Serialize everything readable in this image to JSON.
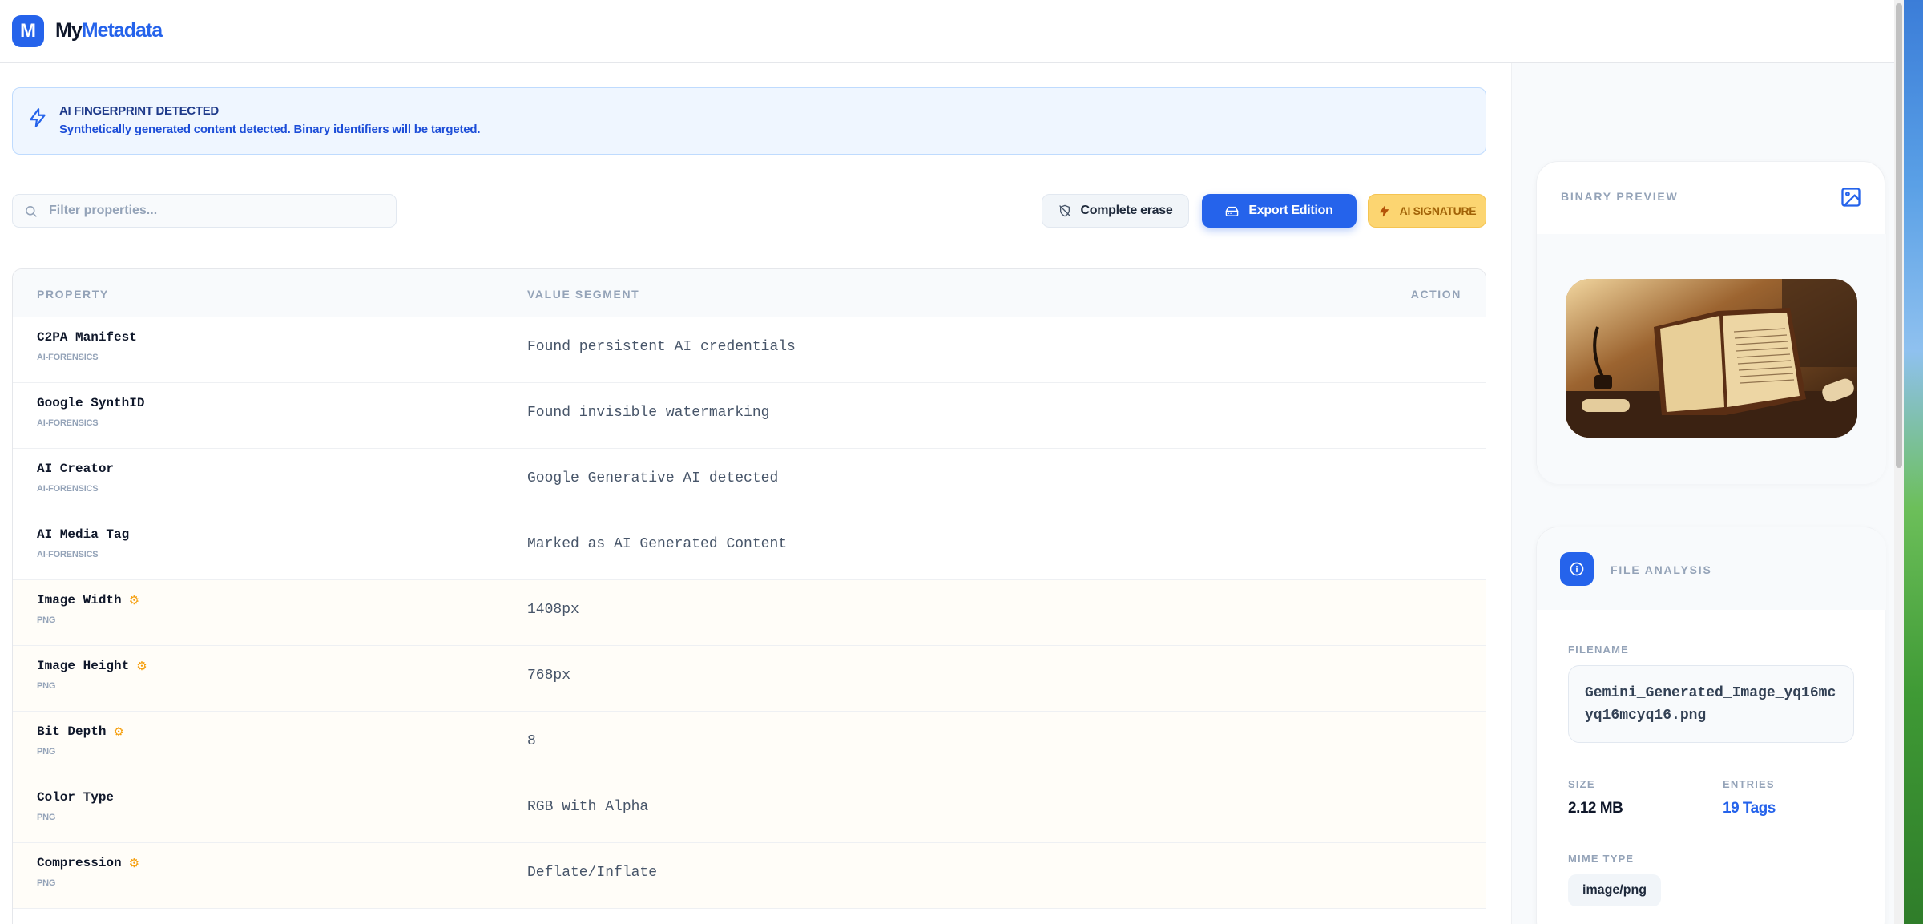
{
  "app": {
    "logo_letter": "M",
    "name_part1": "My",
    "name_part2": "Metadata"
  },
  "alert": {
    "title": "AI FINGERPRINT DETECTED",
    "message": "Synthetically generated content detected. Binary identifiers will be targeted."
  },
  "search": {
    "placeholder": "Filter properties...",
    "value": ""
  },
  "toolbar": {
    "erase_label": "Complete erase",
    "export_label": "Export Edition",
    "signature_label": "AI SIGNATURE"
  },
  "table": {
    "headers": {
      "property": "PROPERTY",
      "value": "VALUE SEGMENT",
      "action": "ACTION"
    },
    "rows": [
      {
        "property": "C2PA Manifest",
        "category": "AI-FORENSICS",
        "value": "Found persistent AI credentials",
        "editable_icon": false
      },
      {
        "property": "Google SynthID",
        "category": "AI-FORENSICS",
        "value": "Found invisible watermarking",
        "editable_icon": false
      },
      {
        "property": "AI Creator",
        "category": "AI-FORENSICS",
        "value": "Google Generative AI detected",
        "editable_icon": false
      },
      {
        "property": "AI Media Tag",
        "category": "AI-FORENSICS",
        "value": "Marked as AI Generated Content",
        "editable_icon": false
      },
      {
        "property": "Image Width",
        "category": "PNG",
        "value": "1408px",
        "editable_icon": true
      },
      {
        "property": "Image Height",
        "category": "PNG",
        "value": "768px",
        "editable_icon": true
      },
      {
        "property": "Bit Depth",
        "category": "PNG",
        "value": "8",
        "editable_icon": true
      },
      {
        "property": "Color Type",
        "category": "PNG",
        "value": "RGB with Alpha",
        "editable_icon": false
      },
      {
        "property": "Compression",
        "category": "PNG",
        "value": "Deflate/Inflate",
        "editable_icon": true
      }
    ]
  },
  "preview": {
    "title": "BINARY PREVIEW",
    "icon": "image-icon"
  },
  "file_analysis": {
    "title": "FILE ANALYSIS",
    "filename_label": "FILENAME",
    "filename": "Gemini_Generated_Image_yq16mcyq16mcyq16.png",
    "size_label": "SIZE",
    "size": "2.12 MB",
    "entries_label": "ENTRIES",
    "entries": "19 Tags",
    "mime_label": "MIME TYPE",
    "mime": "image/png"
  },
  "colors": {
    "accent": "#2563eb",
    "alert_bg": "#eff6ff",
    "signature_bg": "#fcd571",
    "gear": "#f59e0b"
  }
}
